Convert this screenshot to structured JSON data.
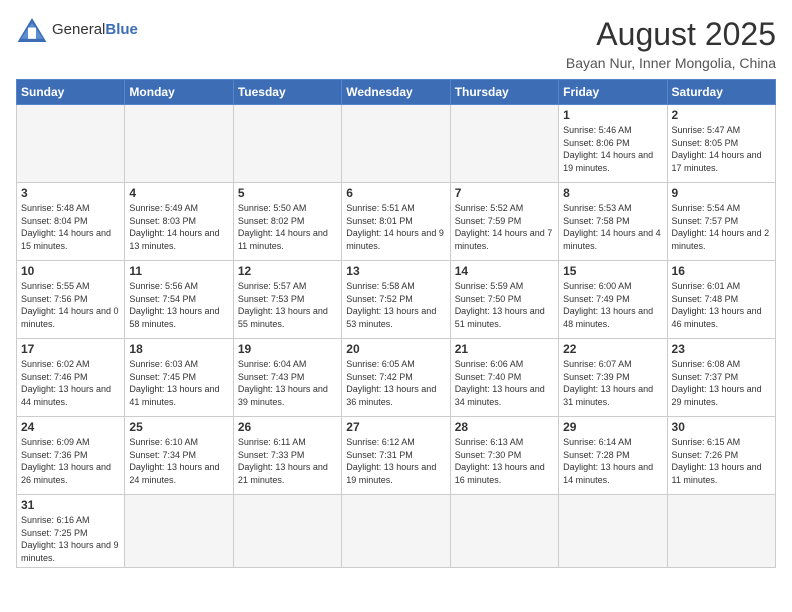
{
  "header": {
    "logo_general": "General",
    "logo_blue": "Blue",
    "month_year": "August 2025",
    "location": "Bayan Nur, Inner Mongolia, China"
  },
  "weekdays": [
    "Sunday",
    "Monday",
    "Tuesday",
    "Wednesday",
    "Thursday",
    "Friday",
    "Saturday"
  ],
  "weeks": [
    [
      {
        "day": "",
        "info": ""
      },
      {
        "day": "",
        "info": ""
      },
      {
        "day": "",
        "info": ""
      },
      {
        "day": "",
        "info": ""
      },
      {
        "day": "",
        "info": ""
      },
      {
        "day": "1",
        "info": "Sunrise: 5:46 AM\nSunset: 8:06 PM\nDaylight: 14 hours and 19 minutes."
      },
      {
        "day": "2",
        "info": "Sunrise: 5:47 AM\nSunset: 8:05 PM\nDaylight: 14 hours and 17 minutes."
      }
    ],
    [
      {
        "day": "3",
        "info": "Sunrise: 5:48 AM\nSunset: 8:04 PM\nDaylight: 14 hours and 15 minutes."
      },
      {
        "day": "4",
        "info": "Sunrise: 5:49 AM\nSunset: 8:03 PM\nDaylight: 14 hours and 13 minutes."
      },
      {
        "day": "5",
        "info": "Sunrise: 5:50 AM\nSunset: 8:02 PM\nDaylight: 14 hours and 11 minutes."
      },
      {
        "day": "6",
        "info": "Sunrise: 5:51 AM\nSunset: 8:01 PM\nDaylight: 14 hours and 9 minutes."
      },
      {
        "day": "7",
        "info": "Sunrise: 5:52 AM\nSunset: 7:59 PM\nDaylight: 14 hours and 7 minutes."
      },
      {
        "day": "8",
        "info": "Sunrise: 5:53 AM\nSunset: 7:58 PM\nDaylight: 14 hours and 4 minutes."
      },
      {
        "day": "9",
        "info": "Sunrise: 5:54 AM\nSunset: 7:57 PM\nDaylight: 14 hours and 2 minutes."
      }
    ],
    [
      {
        "day": "10",
        "info": "Sunrise: 5:55 AM\nSunset: 7:56 PM\nDaylight: 14 hours and 0 minutes."
      },
      {
        "day": "11",
        "info": "Sunrise: 5:56 AM\nSunset: 7:54 PM\nDaylight: 13 hours and 58 minutes."
      },
      {
        "day": "12",
        "info": "Sunrise: 5:57 AM\nSunset: 7:53 PM\nDaylight: 13 hours and 55 minutes."
      },
      {
        "day": "13",
        "info": "Sunrise: 5:58 AM\nSunset: 7:52 PM\nDaylight: 13 hours and 53 minutes."
      },
      {
        "day": "14",
        "info": "Sunrise: 5:59 AM\nSunset: 7:50 PM\nDaylight: 13 hours and 51 minutes."
      },
      {
        "day": "15",
        "info": "Sunrise: 6:00 AM\nSunset: 7:49 PM\nDaylight: 13 hours and 48 minutes."
      },
      {
        "day": "16",
        "info": "Sunrise: 6:01 AM\nSunset: 7:48 PM\nDaylight: 13 hours and 46 minutes."
      }
    ],
    [
      {
        "day": "17",
        "info": "Sunrise: 6:02 AM\nSunset: 7:46 PM\nDaylight: 13 hours and 44 minutes."
      },
      {
        "day": "18",
        "info": "Sunrise: 6:03 AM\nSunset: 7:45 PM\nDaylight: 13 hours and 41 minutes."
      },
      {
        "day": "19",
        "info": "Sunrise: 6:04 AM\nSunset: 7:43 PM\nDaylight: 13 hours and 39 minutes."
      },
      {
        "day": "20",
        "info": "Sunrise: 6:05 AM\nSunset: 7:42 PM\nDaylight: 13 hours and 36 minutes."
      },
      {
        "day": "21",
        "info": "Sunrise: 6:06 AM\nSunset: 7:40 PM\nDaylight: 13 hours and 34 minutes."
      },
      {
        "day": "22",
        "info": "Sunrise: 6:07 AM\nSunset: 7:39 PM\nDaylight: 13 hours and 31 minutes."
      },
      {
        "day": "23",
        "info": "Sunrise: 6:08 AM\nSunset: 7:37 PM\nDaylight: 13 hours and 29 minutes."
      }
    ],
    [
      {
        "day": "24",
        "info": "Sunrise: 6:09 AM\nSunset: 7:36 PM\nDaylight: 13 hours and 26 minutes."
      },
      {
        "day": "25",
        "info": "Sunrise: 6:10 AM\nSunset: 7:34 PM\nDaylight: 13 hours and 24 minutes."
      },
      {
        "day": "26",
        "info": "Sunrise: 6:11 AM\nSunset: 7:33 PM\nDaylight: 13 hours and 21 minutes."
      },
      {
        "day": "27",
        "info": "Sunrise: 6:12 AM\nSunset: 7:31 PM\nDaylight: 13 hours and 19 minutes."
      },
      {
        "day": "28",
        "info": "Sunrise: 6:13 AM\nSunset: 7:30 PM\nDaylight: 13 hours and 16 minutes."
      },
      {
        "day": "29",
        "info": "Sunrise: 6:14 AM\nSunset: 7:28 PM\nDaylight: 13 hours and 14 minutes."
      },
      {
        "day": "30",
        "info": "Sunrise: 6:15 AM\nSunset: 7:26 PM\nDaylight: 13 hours and 11 minutes."
      }
    ],
    [
      {
        "day": "31",
        "info": "Sunrise: 6:16 AM\nSunset: 7:25 PM\nDaylight: 13 hours and 9 minutes."
      },
      {
        "day": "",
        "info": ""
      },
      {
        "day": "",
        "info": ""
      },
      {
        "day": "",
        "info": ""
      },
      {
        "day": "",
        "info": ""
      },
      {
        "day": "",
        "info": ""
      },
      {
        "day": "",
        "info": ""
      }
    ]
  ]
}
